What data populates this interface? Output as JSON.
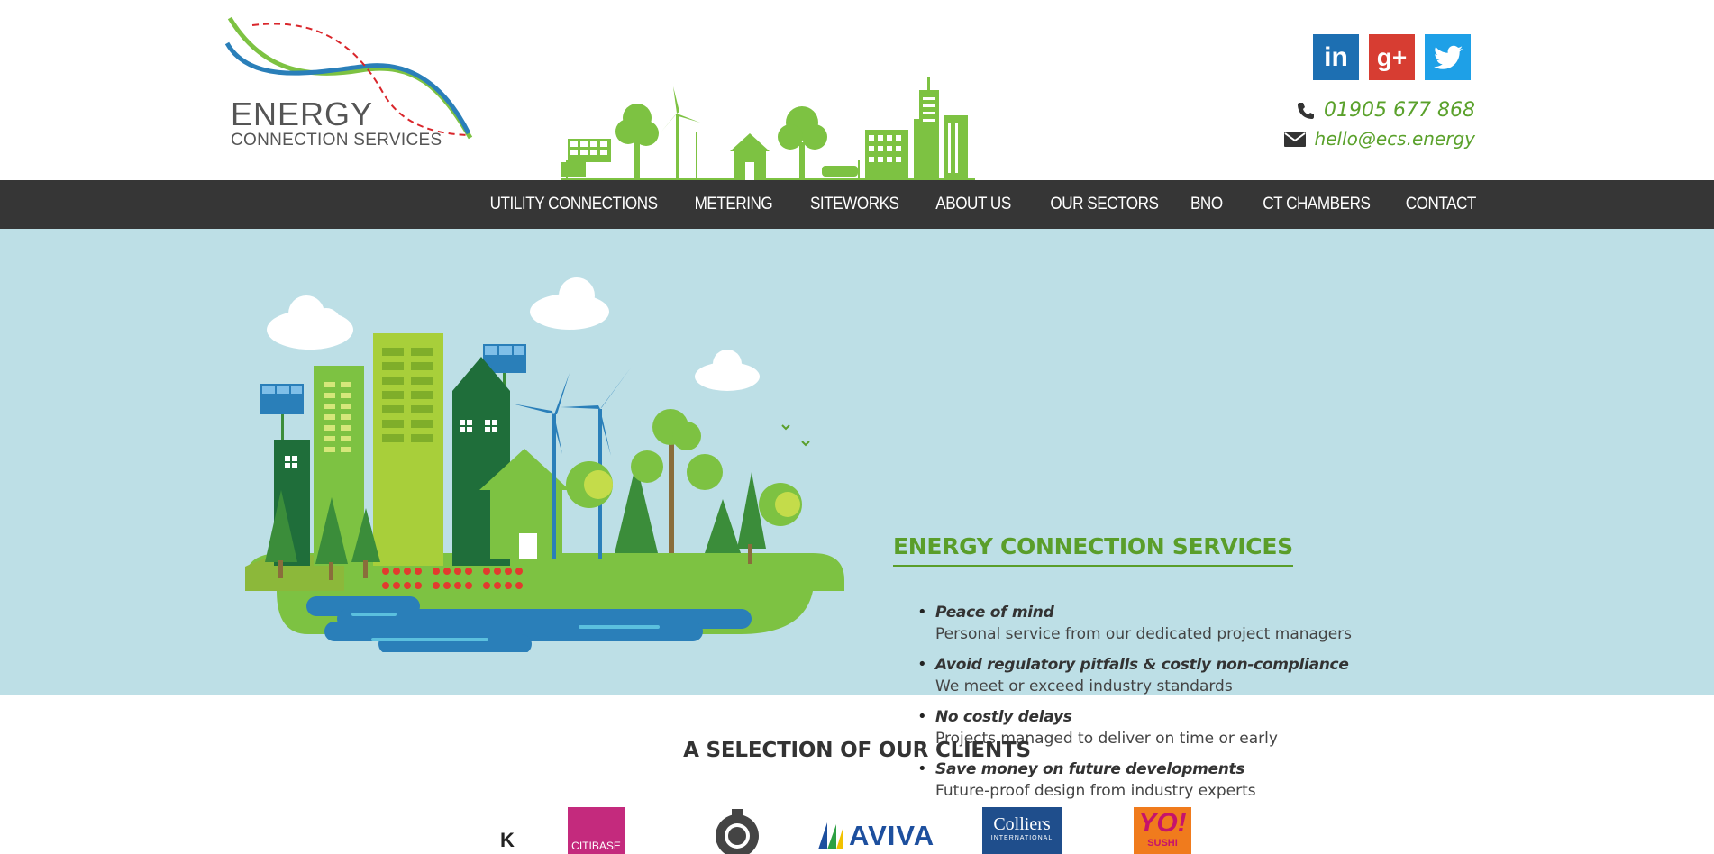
{
  "brand": {
    "logo_big": "ENERGY",
    "logo_small": "CONNECTION SERVICES",
    "green": "#5a9e2a",
    "blue": "#2a7fb9"
  },
  "social": {
    "linkedin_label": "in",
    "googleplus_label": "g+",
    "twitter_icon": "twitter-bird-icon"
  },
  "contact": {
    "phone": "01905 677 868",
    "email": "hello@ecs.energy",
    "phone_icon": "phone-icon",
    "email_icon": "envelope-icon"
  },
  "nav": {
    "items": [
      {
        "label": "UTILITY CONNECTIONS"
      },
      {
        "label": "METERING"
      },
      {
        "label": "SITEWORKS"
      },
      {
        "label": "ABOUT US"
      },
      {
        "label": "OUR SECTORS"
      },
      {
        "label": "BNO"
      },
      {
        "label": "CT CHAMBERS"
      },
      {
        "label": "CONTACT"
      }
    ],
    "background": "#363636"
  },
  "hero": {
    "title": "ENERGY CONNECTION SERVICES",
    "background": "#bddfe6",
    "benefits": [
      {
        "title": "Peace of mind",
        "desc": "Personal service from our dedicated project managers"
      },
      {
        "title": "Avoid regulatory pitfalls & costly non-compliance",
        "desc": "We meet or exceed industry standards"
      },
      {
        "title": "No costly delays",
        "desc": "Projects managed to deliver on time or early"
      },
      {
        "title": "Save money on future developments",
        "desc": "Future-proof design from industry experts"
      }
    ]
  },
  "clients": {
    "title": "A SELECTION OF OUR CLIENTS",
    "logos": [
      {
        "text": "K"
      },
      {
        "text": "CITIBASE"
      },
      {
        "text": ""
      },
      {
        "text": "AVIVA"
      },
      {
        "text": "Colliers",
        "sub": "INTERNATIONAL"
      },
      {
        "text": "YO!",
        "sub": "SUSHI"
      }
    ]
  }
}
